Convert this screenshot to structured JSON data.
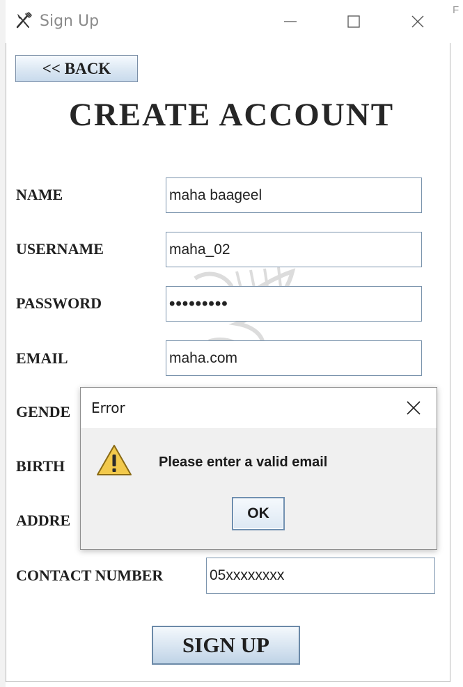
{
  "window": {
    "title": "Sign Up",
    "icon": "fork-knife-icon",
    "controls": [
      "minimize-icon",
      "maximize-icon",
      "close-icon"
    ]
  },
  "edge_text": "F",
  "back_button": {
    "label": "<< BACK"
  },
  "page_title": "CREATE ACCOUNT",
  "form": {
    "name": {
      "label": "NAME",
      "value": "maha baageel"
    },
    "username": {
      "label": "USERNAME",
      "value": "maha_02"
    },
    "password": {
      "label": "PASSWORD",
      "value": "•••••••••"
    },
    "email": {
      "label": "EMAIL",
      "value": "maha.com"
    },
    "gender": {
      "label": "GENDE"
    },
    "birth_date": {
      "label": "BIRTH"
    },
    "address": {
      "label": "ADDRE"
    },
    "contact": {
      "label": "CONTACT NUMBER",
      "value": "05xxxxxxxx"
    }
  },
  "signup_button": {
    "label": "SIGN UP"
  },
  "dialog": {
    "title": "Error",
    "icon": "warning-icon",
    "message": "Please enter a valid email",
    "ok_label": "OK"
  },
  "colors": {
    "button_border": "#7a8ea6",
    "input_border": "#7b94ad",
    "warning_fill": "#f2c94c"
  }
}
